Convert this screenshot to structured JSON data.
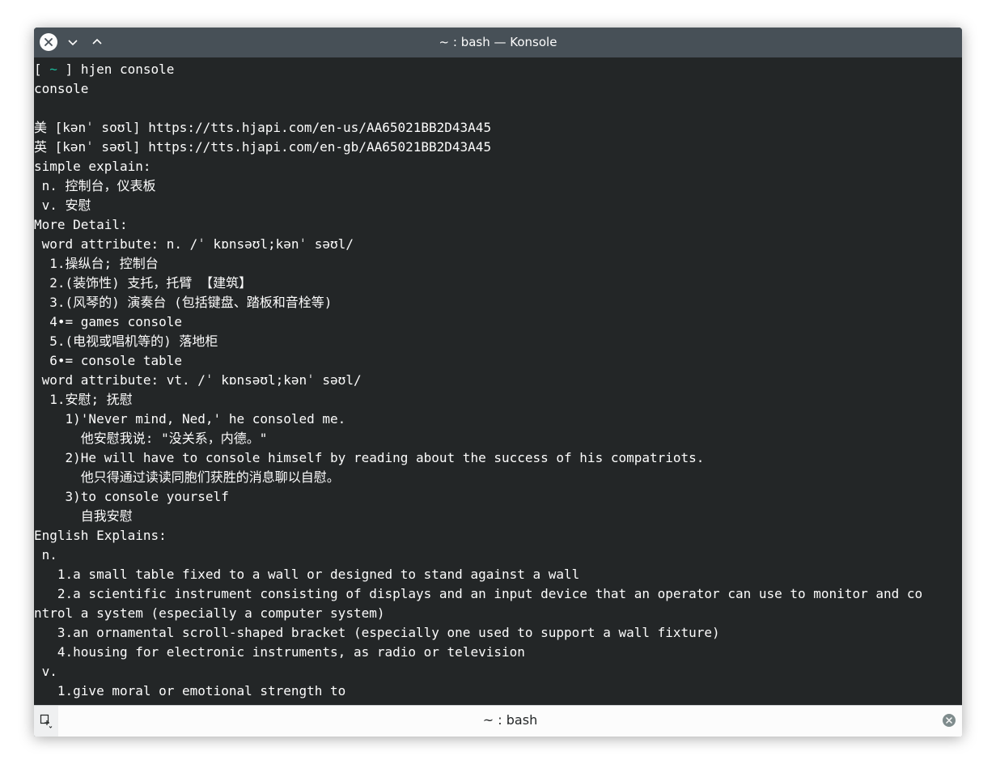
{
  "window": {
    "title": "~ : bash — Konsole"
  },
  "terminal": {
    "prompt_open": "[ ",
    "prompt_tilde": "~",
    "prompt_close": " ] ",
    "command": "hjen console",
    "lines": [
      "console",
      "",
      "美 [kənˈ soʊl] https://tts.hjapi.com/en-us/AA65021BB2D43A45",
      "英 [kənˈ səʊl] https://tts.hjapi.com/en-gb/AA65021BB2D43A45",
      "simple explain:",
      " n. 控制台，仪表板",
      " v. 安慰",
      "More Detail:",
      " word attribute: n. /ˈ kɒnsəʊl;kənˈ səʊl/",
      "  1.操纵台; 控制台",
      "  2.(装饰性) 支托，托臂 【建筑】",
      "  3.(风琴的) 演奏台 (包括键盘、踏板和音栓等)",
      "  4•= games console",
      "  5.(电视或唱机等的) 落地柜",
      "  6•= console table",
      " word attribute: vt. /ˈ kɒnsəʊl;kənˈ səʊl/",
      "  1.安慰; 抚慰",
      "    1)'Never mind, Ned,' he consoled me.",
      "      他安慰我说: \"没关系，内德。\"",
      "    2)He will have to console himself by reading about the success of his compatriots.",
      "      他只得通过读读同胞们获胜的消息聊以自慰。",
      "    3)to console yourself",
      "      自我安慰",
      "English Explains:",
      " n.",
      "   1.a small table fixed to a wall or designed to stand against a wall",
      "   2.a scientific instrument consisting of displays and an input device that an operator can use to monitor and co",
      "ntrol a system (especially a computer system)",
      "   3.an ornamental scroll-shaped bracket (especially one used to support a wall fixture)",
      "   4.housing for electronic instruments, as radio or television",
      " v.",
      "   1.give moral or emotional strength to"
    ]
  },
  "tabbar": {
    "tab_label": "~ : bash"
  },
  "icons": {
    "close": "close-icon",
    "minimize": "chevron-down-icon",
    "maximize": "chevron-up-icon",
    "new_tab": "new-tab-icon",
    "tab_close": "tab-close-icon"
  },
  "colors": {
    "titlebar": "#475057",
    "terminal_bg": "#232627",
    "terminal_fg": "#fcfcfc",
    "prompt_accent": "#1abc9c"
  }
}
